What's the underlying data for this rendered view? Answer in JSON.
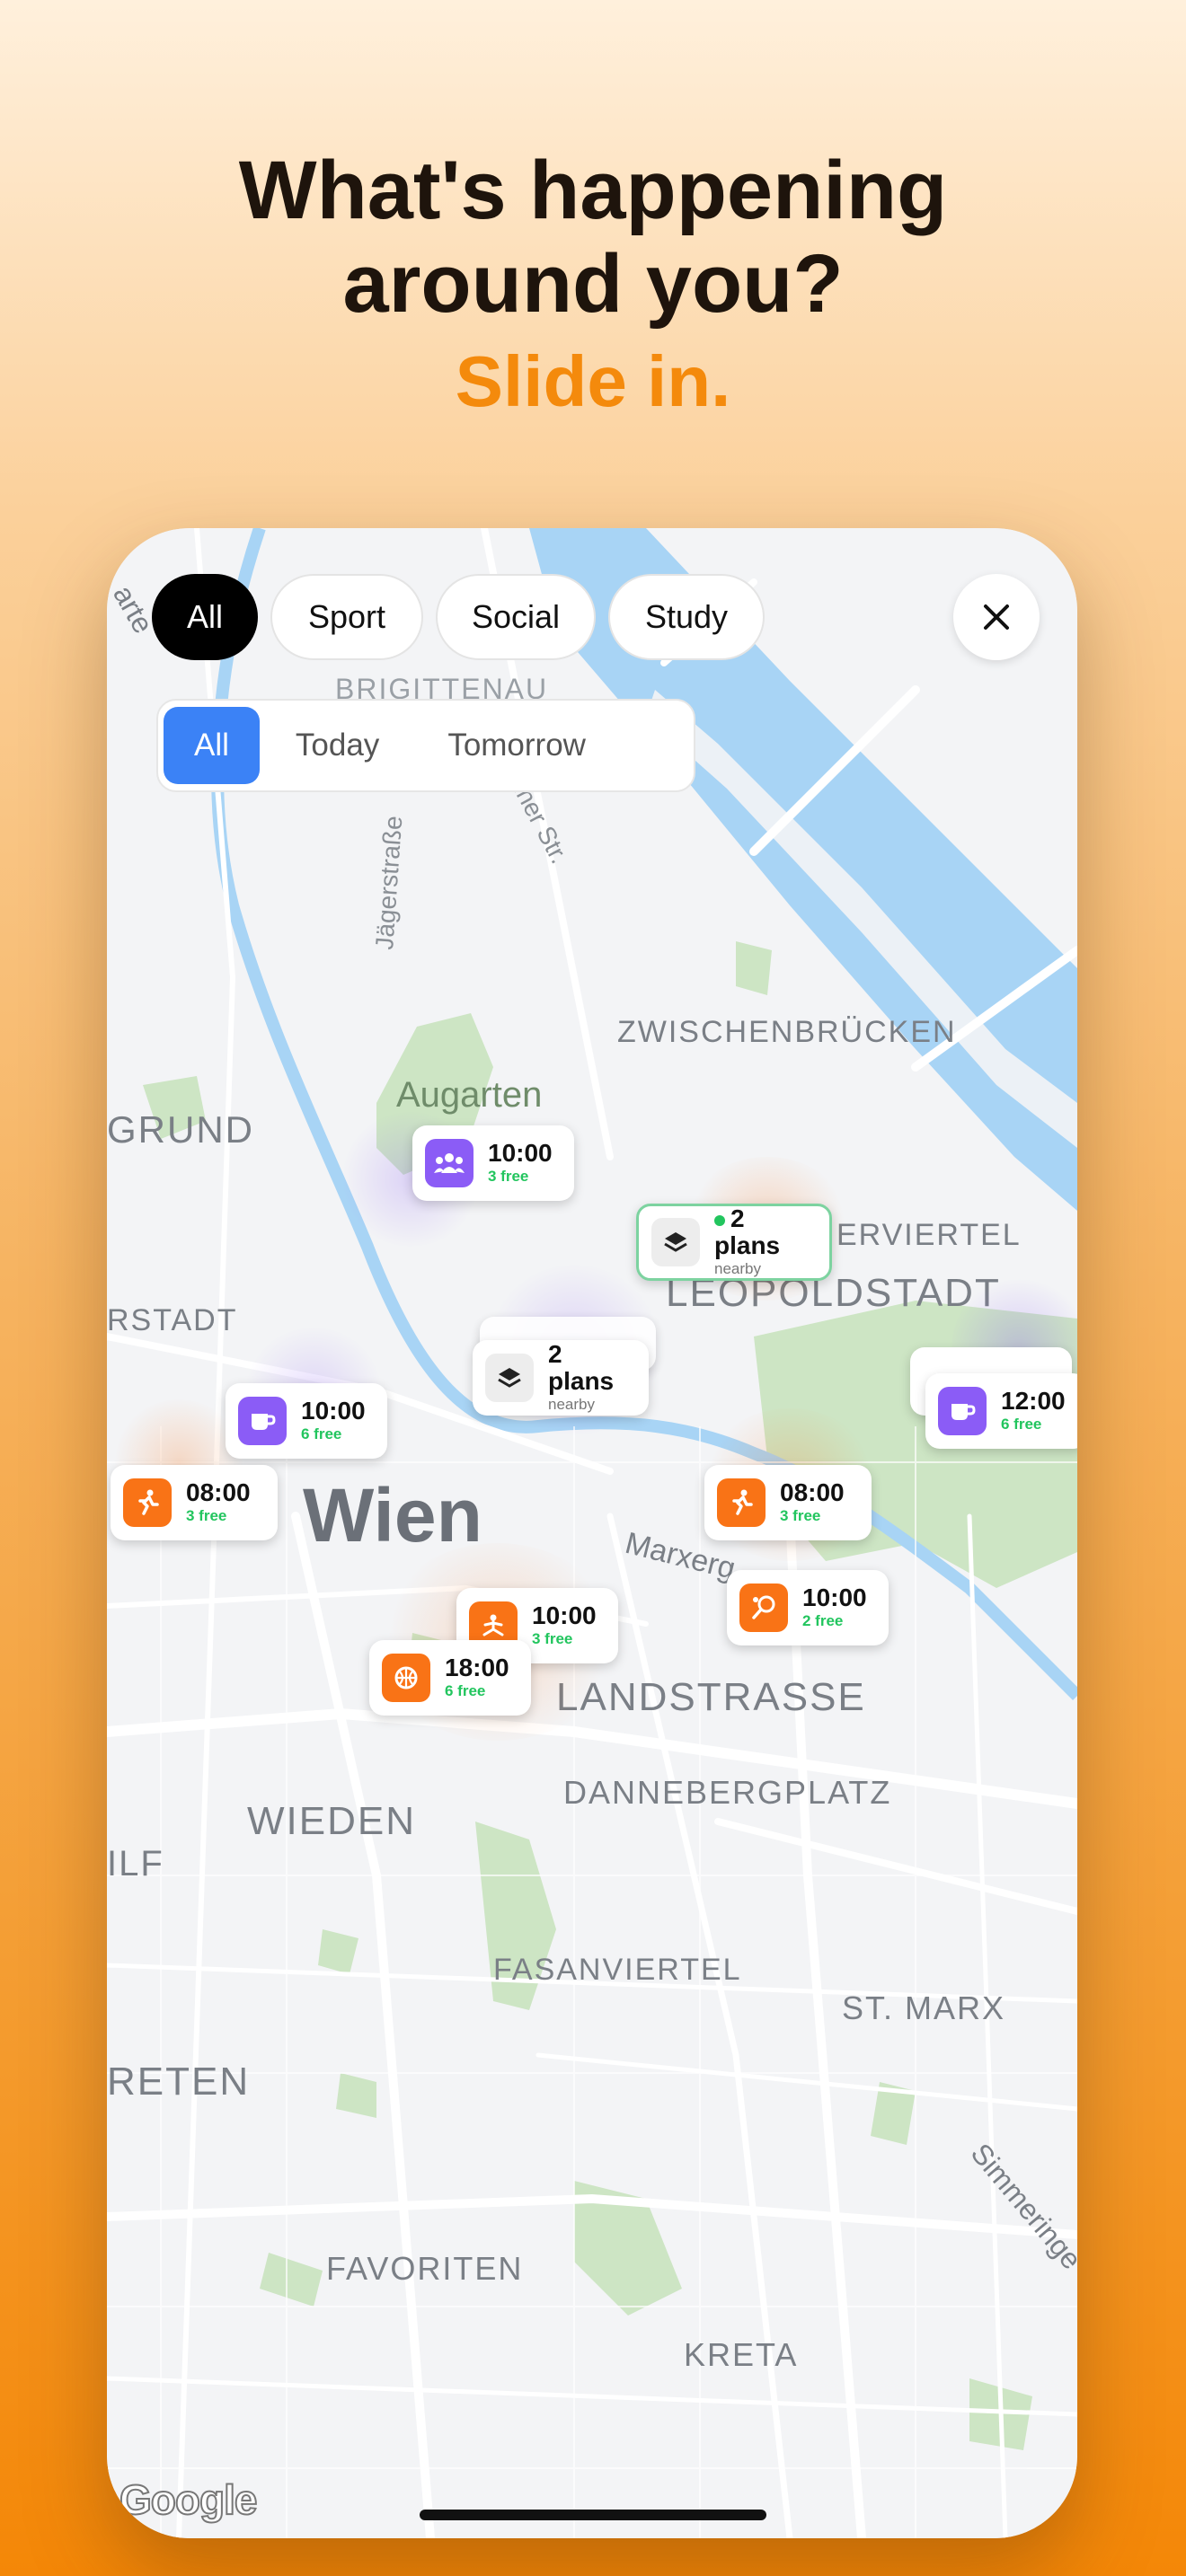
{
  "headline": {
    "line1": "What's happening",
    "line2": "around you?",
    "line3": "Slide in."
  },
  "filters": {
    "category_chips": [
      "All",
      "Sport",
      "Social",
      "Study"
    ],
    "selected_category": "All",
    "day_tabs": [
      "All",
      "Today",
      "Tomorrow"
    ],
    "selected_day": "All",
    "close_icon": "close-icon"
  },
  "map": {
    "labels": {
      "brigittenau": "BRIGITTENAU",
      "jaegerstrasse": "Jägerstraße",
      "dresdner": "Dresdner Str.",
      "zwischenbruecken": "ZWISCHENBRÜCKEN",
      "augarten": "Augarten",
      "grund": "GRUND",
      "stuwerviertel": "ERVIERTEL",
      "leopoldstadt": "LEOPOLDSTADT",
      "rstadt": "RSTADT",
      "wien": "Wien",
      "marxergasse": "Marxerg",
      "landstrasse": "LANDSTRASSE",
      "dannebergplatz": "DANNEBERGPLATZ",
      "wieden": "WIEDEN",
      "ilf": "ILF",
      "fasanviertel": "FASANVIERTEL",
      "st_marx": "ST. MARX",
      "reten": "RETEN",
      "simmeringer": "Simmeringe",
      "favoriten": "FAVORITEN",
      "kreta": "KRETA",
      "arte": "arte"
    },
    "attribution": "Google",
    "colors": {
      "water": "#A8D4F5",
      "park": "#CDE5C4",
      "land": "#F3F4F6",
      "road": "#FFFFFF"
    }
  },
  "markers": [
    {
      "id": "m1",
      "category": "social",
      "icon": "group-icon",
      "time": "10:00",
      "free": "3 free"
    },
    {
      "id": "c1",
      "category": "cluster",
      "icon": "layers-icon",
      "title": "2 plans",
      "sub": "nearby",
      "active": true
    },
    {
      "id": "c2",
      "category": "cluster",
      "icon": "layers-icon",
      "title": "2 plans",
      "sub": "nearby"
    },
    {
      "id": "m2",
      "category": "social",
      "icon": "coffee-icon",
      "time": "10:00",
      "free": "6 free"
    },
    {
      "id": "m3",
      "category": "social",
      "icon": "coffee-icon",
      "time": "12:00",
      "free": "6 free"
    },
    {
      "id": "m4",
      "category": "sport",
      "icon": "running-icon",
      "time": "08:00",
      "free": "3 free"
    },
    {
      "id": "m5",
      "category": "sport",
      "icon": "running-icon",
      "time": "08:00",
      "free": "3 free"
    },
    {
      "id": "m6",
      "category": "sport",
      "icon": "tennis-icon",
      "time": "10:00",
      "free": "2 free"
    },
    {
      "id": "m7",
      "category": "sport",
      "icon": "yoga-icon",
      "time": "10:00",
      "free": "3 free"
    },
    {
      "id": "m8",
      "category": "sport",
      "icon": "basketball-icon",
      "time": "18:00",
      "free": "6 free"
    }
  ],
  "colors": {
    "accent_orange": "#F48A0C",
    "social_purple": "#8B5CF6",
    "sport_orange": "#F97316",
    "free_green": "#22C55E",
    "selected_blue": "#3B82F6"
  }
}
